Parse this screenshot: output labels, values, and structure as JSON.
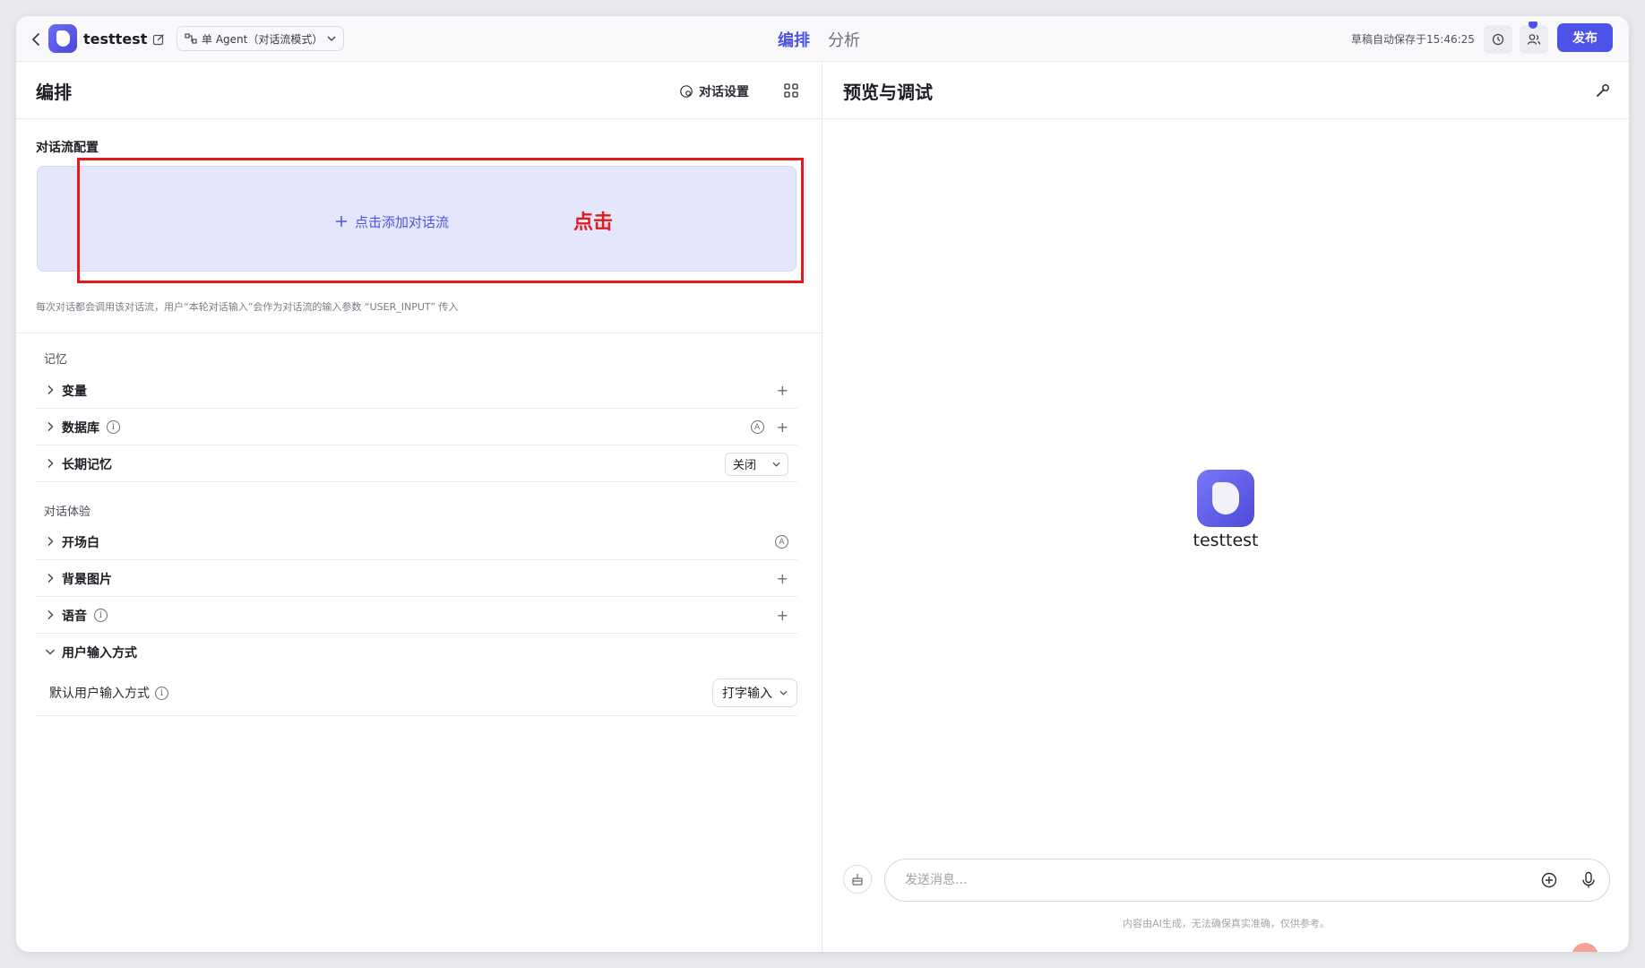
{
  "header": {
    "app_name": "testtest",
    "mode_label": "单 Agent（对话流模式）",
    "tabs": [
      {
        "label": "编排",
        "active": true
      },
      {
        "label": "分析",
        "active": false
      }
    ],
    "autosave": "草稿自动保存于15:46:25",
    "publish_label": "发布"
  },
  "left": {
    "title": "编排",
    "conversation_settings": "对话设置",
    "flow_section": "对话流配置",
    "add_flow": "点击添加对话流",
    "annotation": "点击",
    "hint": "每次对话都会调用该对话流，用户“本轮对话输入”会作为对话流的输入参数 “USER_INPUT” 传入",
    "memory_group": "记忆",
    "memory_items": [
      {
        "label": "变量"
      },
      {
        "label": "数据库"
      },
      {
        "label": "长期记忆",
        "value": "关闭"
      }
    ],
    "experience_group": "对话体验",
    "experience_items": [
      {
        "label": "开场白"
      },
      {
        "label": "背景图片"
      },
      {
        "label": "语音"
      },
      {
        "label": "用户输入方式"
      }
    ],
    "input_mode": {
      "label": "默认用户输入方式",
      "value": "打字输入"
    }
  },
  "right": {
    "title": "预览与调试",
    "bot_name": "testtest",
    "message_placeholder": "发送消息...",
    "disclaimer": "内容由AI生成，无法确保真实准确，仅供参考。"
  },
  "colors": {
    "accent": "#4d53e8",
    "annotation_red": "#e11b1b",
    "flow_box_bg": "#e4e6fb"
  }
}
